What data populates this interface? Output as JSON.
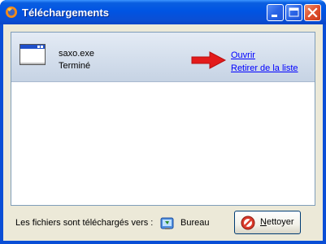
{
  "window": {
    "title": "Téléchargements",
    "icon": "firefox-icon"
  },
  "titlebar_buttons": {
    "minimize": "minimize-icon",
    "maximize": "maximize-icon",
    "close": "close-icon"
  },
  "downloads": [
    {
      "file_name": "saxo.exe",
      "status": "Terminé",
      "icon": "application-window-icon",
      "actions": {
        "open": "Ouvrir",
        "remove": "Retirer de la liste"
      }
    }
  ],
  "footer": {
    "label": "Les fichiers sont téléchargés vers :",
    "folder_icon": "desktop-folder-icon",
    "folder_name": "Bureau",
    "clean_button_mnemonic": "N",
    "clean_button_rest": "ettoyer"
  },
  "colors": {
    "titlebar": "#0054e3",
    "selected_row": "#c6d3e4",
    "link": "#0000ff",
    "annotation_arrow": "#e31b1b",
    "window_body": "#ece9d8"
  }
}
